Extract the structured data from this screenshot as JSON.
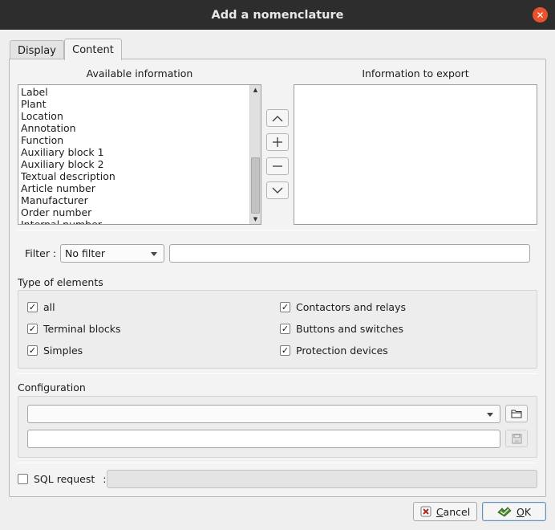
{
  "window": {
    "title": "Add a nomenclature"
  },
  "tabs": [
    {
      "label": "Display"
    },
    {
      "label": "Content"
    }
  ],
  "available": {
    "title": "Available information",
    "items": [
      "Label",
      "Plant",
      "Location",
      "Annotation",
      "Function",
      "Auxiliary block 1",
      "Auxiliary block 2",
      "Textual description",
      "Article number",
      "Manufacturer",
      "Order number",
      "Internal number"
    ]
  },
  "export": {
    "title": "Information to export"
  },
  "filter": {
    "label": "Filter :",
    "selected": "No filter",
    "text": ""
  },
  "types": {
    "title": "Type of elements",
    "items": [
      {
        "label": "all",
        "checked": true
      },
      {
        "label": "Contactors and relays",
        "checked": true
      },
      {
        "label": "Terminal blocks",
        "checked": true
      },
      {
        "label": "Buttons and switches",
        "checked": true
      },
      {
        "label": "Simples",
        "checked": true
      },
      {
        "label": "Protection devices",
        "checked": true
      }
    ]
  },
  "configuration": {
    "title": "Configuration",
    "selected": "",
    "name": ""
  },
  "sql": {
    "label": "SQL request",
    "colon": ":",
    "checked": false,
    "value": ""
  },
  "buttons": {
    "cancel": {
      "mnemonic": "C",
      "rest": "ancel"
    },
    "ok": {
      "mnemonic": "O",
      "rest": "K"
    }
  },
  "colors": {
    "titlebar": "#2d2d2d",
    "close": "#e9522c",
    "ok_icon": "#4e8c2e"
  }
}
